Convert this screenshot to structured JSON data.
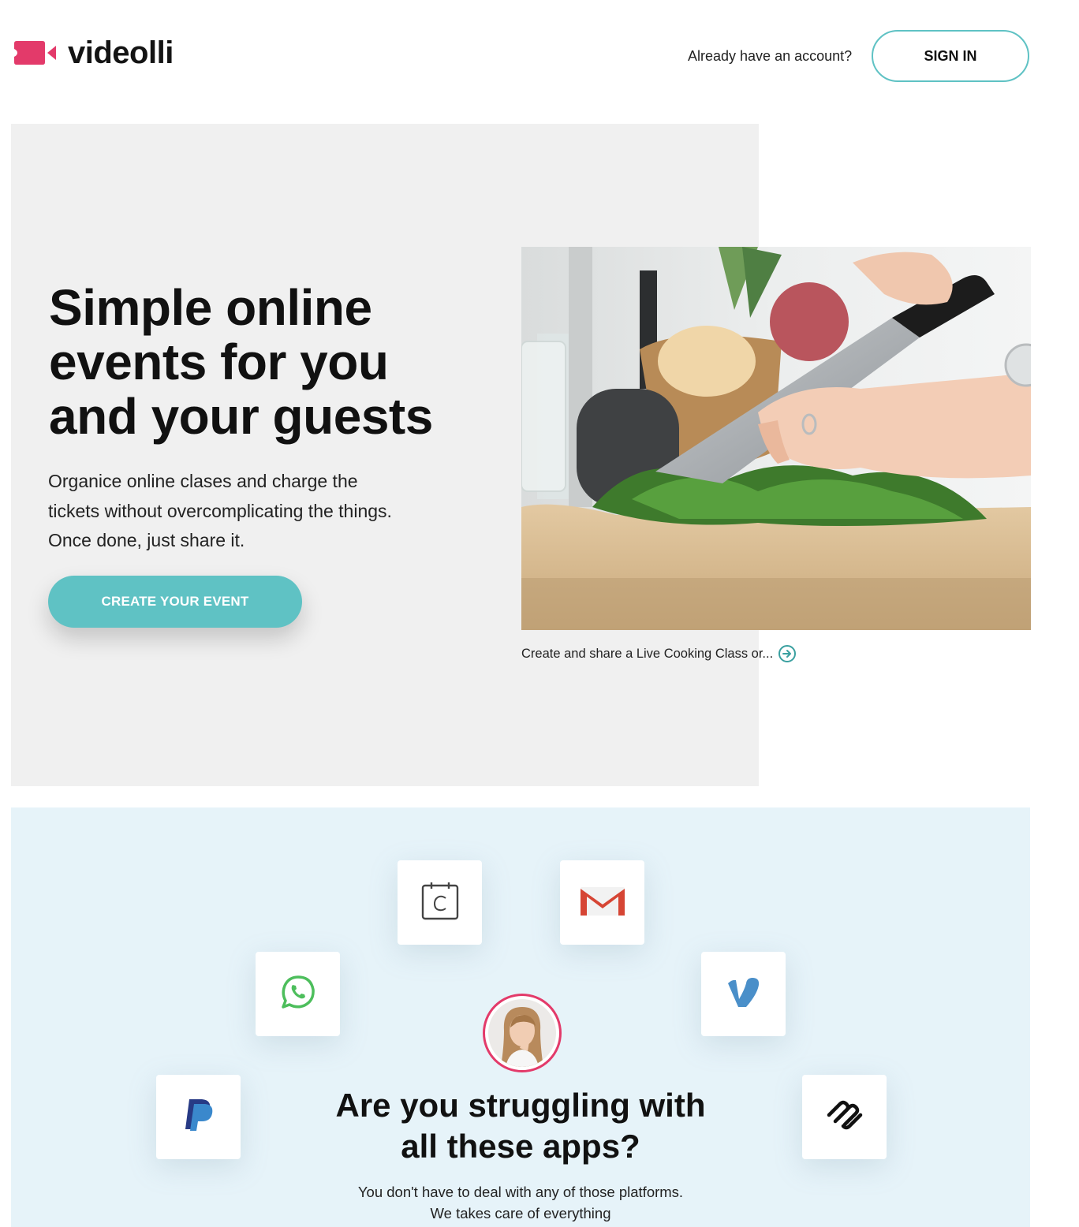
{
  "header": {
    "brand": "videolli",
    "account_prompt": "Already have an account?",
    "signin_label": "SIGN IN",
    "accent_color": "#5fc2c4",
    "brand_color": "#e33a6a"
  },
  "hero": {
    "title_lines": [
      "Simple online",
      "events for you",
      "and your guests"
    ],
    "subtitle_lines": [
      "Organice online clases and charge the",
      "tickets without overcomplicating the things.",
      "Once done, just share it."
    ],
    "cta_label": "CREATE YOUR EVENT",
    "caption": "Create and share a Live Cooking Class or...",
    "caption_icon": "arrow-right-circle-icon"
  },
  "apps": {
    "icons": [
      "calendly-icon",
      "gmail-icon",
      "whatsapp-icon",
      "vimeo-icon",
      "paypal-icon",
      "squarespace-icon"
    ],
    "title_lines": [
      "Are you struggling with",
      "all these apps?"
    ],
    "subtitle_lines": [
      "You don't have to deal with any of those platforms.",
      "We takes care of everything"
    ]
  }
}
